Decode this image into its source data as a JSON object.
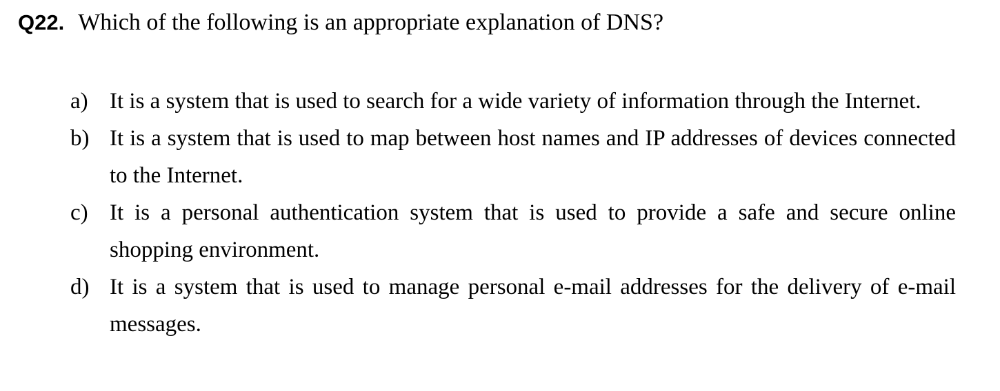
{
  "question": {
    "number": "Q22.",
    "text": "Which of the following is an appropriate explanation of DNS?"
  },
  "options": [
    {
      "letter": "a)",
      "text": "It is a system that is used to search for a wide variety of information through the Internet."
    },
    {
      "letter": "b)",
      "text": "It is a system that is used to map between host names and IP addresses of devices connected to the Internet."
    },
    {
      "letter": "c)",
      "text": "It is a personal authentication system that is used to provide a safe and secure online shopping environment."
    },
    {
      "letter": "d)",
      "text": "It is a system that is used to manage personal e-mail addresses for the delivery of e-mail messages."
    }
  ]
}
